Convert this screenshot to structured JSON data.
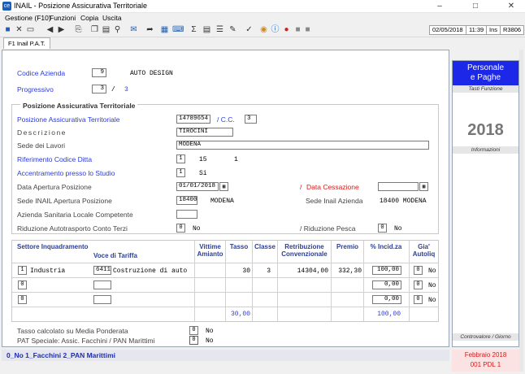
{
  "window": {
    "title": "INAIL - Posizione Assicurativa Territoriale",
    "icon_text": "ce"
  },
  "menu": [
    "Gestione (F10)",
    "Funzioni",
    "Copia",
    "Uscita"
  ],
  "status": {
    "date": "02/05/2018",
    "time": "11:39",
    "ins": "Ins",
    "code": "R3806"
  },
  "tab": "F1 Inail P.A.T.",
  "header": {
    "codice_label": "Codice Azienda",
    "codice_value": "9",
    "codice_name": "AUTO DESIGN",
    "progressivo_label": "Progressivo",
    "progressivo_value": "3",
    "progressivo_sep": "/",
    "progressivo_total": "3"
  },
  "group": {
    "title": "Posizione Assicurativa Territoriale",
    "pat_label": "Posizione Assicurativa Territoriale",
    "pat_value": "14789654",
    "cc_label": "/ C.C.",
    "cc_value": "3",
    "descrizione_label": "Descrizione",
    "descrizione_value": "TIROCINI",
    "sede_lavori_label": "Sede dei Lavori",
    "sede_lavori_value": "MODENA",
    "rif_ditta_label": "Riferimento Codice Ditta",
    "rif_ditta_check": "1",
    "rif_ditta_v1": "15",
    "rif_ditta_v2": "1",
    "accentramento_label": "Accentramento presso lo Studio",
    "accentramento_check": "1",
    "accentramento_value": "Si",
    "data_apertura_label": "Data Apertura Posizione",
    "data_apertura_value": "01/01/2018",
    "data_cessazione_slash": "/",
    "data_cessazione_label": "Data Cessazione",
    "data_cessazione_value": "",
    "sede_apertura_label": "Sede INAIL Apertura Posizione",
    "sede_apertura_code": "18400",
    "sede_apertura_name": "MODENA",
    "sede_azienda_label": "Sede Inail Azienda",
    "sede_azienda_value": "18400 MODENA",
    "asl_label": "Azienda Sanitaria Locale Competente",
    "asl_value": "",
    "rid_autotrasporto_label": "Riduzione Autotrasporto Conto Terzi",
    "rid_autotrasporto_check": "0",
    "rid_autotrasporto_value": "No",
    "rid_pesca_label": "/ Riduzione Pesca",
    "rid_pesca_check": "0",
    "rid_pesca_value": "No"
  },
  "table": {
    "headers": {
      "settore": "Settore Inquadramento",
      "voce": "Voce di Tariffa",
      "vittime": "Vittime Amianto",
      "tasso": "Tasso",
      "classe": "Classe",
      "retribuzione": "Retribuzione Convenzionale",
      "premio": "Premio",
      "incid": "% Incid.za",
      "autoliq": "Gia' Autoliq"
    },
    "rows": [
      {
        "settore_code": "1",
        "settore_name": "Industria",
        "voce_code": "6411",
        "voce_name": "Costruzione di auto",
        "tasso": "30",
        "classe": "3",
        "retribuzione": "14304,00",
        "premio": "332,30",
        "incid": "100,00",
        "autoliq_check": "0",
        "autoliq": "No"
      },
      {
        "settore_code": "0",
        "settore_name": "",
        "voce_code": "",
        "voce_name": "",
        "tasso": "",
        "classe": "",
        "retribuzione": "",
        "premio": "",
        "incid": "0,00",
        "autoliq_check": "0",
        "autoliq": "No"
      },
      {
        "settore_code": "0",
        "settore_name": "",
        "voce_code": "",
        "voce_name": "",
        "tasso": "",
        "classe": "",
        "retribuzione": "",
        "premio": "",
        "incid": "0,00",
        "autoliq_check": "0",
        "autoliq": "No"
      }
    ],
    "total_tasso": "30,00",
    "total_incid": "100,00"
  },
  "footer": {
    "media_label": "Tasso calcolato su Media Ponderata",
    "media_check": "0",
    "media_value": "No",
    "pat_speciale_label": "PAT Speciale: Assic. Facchini / PAN Marittimi",
    "pat_speciale_check": "0",
    "pat_speciale_value": "No"
  },
  "statusbar": "0_No  1_Facchini  2_PAN Marittimi",
  "sidebar": {
    "brand_line1": "Personale",
    "brand_line2": "e Paghe",
    "tasti": "Tasti Funzione",
    "year": "2018",
    "informazioni": "Informazioni",
    "controvalore": "Controvalore / Giorno",
    "period": "Febbraio 2018",
    "pdl": "001 PDL 1"
  },
  "colors": {
    "accent_blue": "#2a3be0",
    "brand_blue": "#1d27e8",
    "status_red": "#d41c1c",
    "header_navy": "#2b3f97"
  }
}
